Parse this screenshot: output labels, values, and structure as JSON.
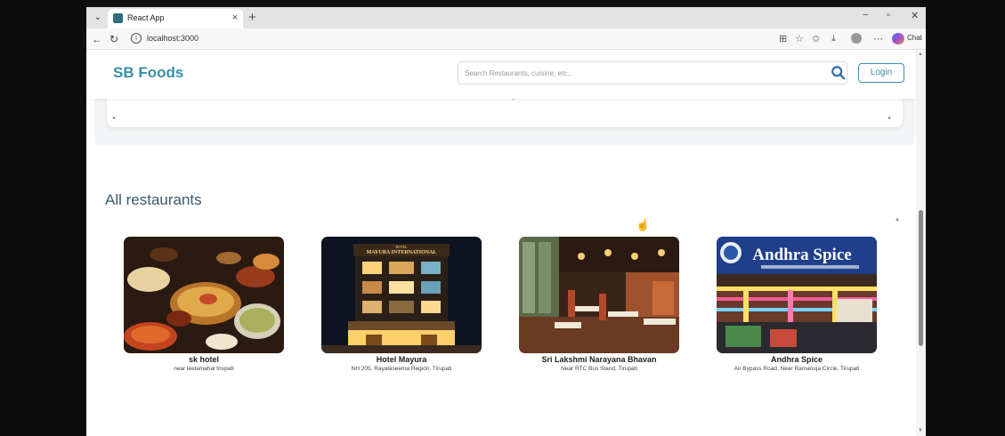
{
  "browser": {
    "tab_title": "React App",
    "tab_close": "×",
    "new_tab": "+",
    "url": "localhost:3000",
    "chat_label": "Chat",
    "minimize": "−",
    "restore": "▫",
    "close": "✕"
  },
  "header": {
    "logo": "SB Foods",
    "search_placeholder": "Search Restaurants, cuisine, etc.,",
    "login_label": "Login"
  },
  "carousel": {
    "caption": "Tirupati",
    "prev_arrow": "◂",
    "next_arrow": "▸"
  },
  "section": {
    "title": "All restaurants"
  },
  "restaurants": [
    {
      "name": "sk hotel",
      "address": "near leelamahal tirupati"
    },
    {
      "name": "Hotel Mayura",
      "address": "NH 205, Rayalaseema Region, Tirupati",
      "sign_line1": "HOTEL",
      "sign_line2": "MAYURA INTERNATIONAL"
    },
    {
      "name": "Sri Lakshmi Narayana Bhavan",
      "address": "Near RTC Bus Stand, Tirupati"
    },
    {
      "name": "Andhra Spice",
      "address": "Air Bypass Road, Near Ramanuja Circle, Tirupati",
      "sign": "Andhra Spice"
    }
  ],
  "colors": {
    "brand": "#3a8fa8",
    "section_title": "#3b5a6e"
  }
}
